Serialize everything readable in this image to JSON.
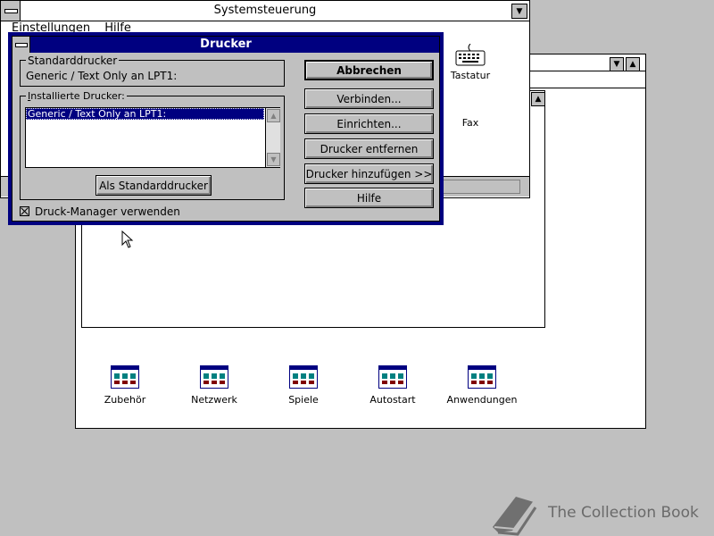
{
  "program_manager": {
    "groups": [
      {
        "label": "Zubehör",
        "icon": "program-group-icon"
      },
      {
        "label": "Netzwerk",
        "icon": "program-group-icon"
      },
      {
        "label": "Spiele",
        "icon": "program-group-icon"
      },
      {
        "label": "Autostart",
        "icon": "program-group-icon"
      },
      {
        "label": "Anwendungen",
        "icon": "program-group-icon"
      }
    ]
  },
  "control_panel": {
    "title": "Systemsteuerung",
    "menu": [
      "Einstellungen",
      "Hilfe"
    ],
    "items": [
      {
        "label": "Tastatur",
        "icon": "keyboard-icon"
      },
      {
        "label": "Fax",
        "icon": "fax-icon"
      }
    ]
  },
  "dialog": {
    "title": "Drucker",
    "default_printer_label": "Standarddrucker",
    "default_printer_value": "Generic / Text Only an LPT1:",
    "installed_label": "Installierte Drucker:",
    "installed_list": [
      "Generic / Text Only an LPT1:"
    ],
    "set_default_button": "Als Standarddrucker",
    "print_manager_checkbox": "Druck-Manager verwenden",
    "print_manager_checked": true,
    "buttons": {
      "cancel": "Abbrechen",
      "connect": "Verbinden...",
      "setup": "Einrichten...",
      "remove": "Drucker entfernen",
      "add": "Drucker hinzufügen >>",
      "help": "Hilfe"
    }
  },
  "watermark": {
    "text": "The Collection Book",
    "icon": "book-icon"
  },
  "colors": {
    "desktop": "#c0c0c0",
    "titlebar_active": "#000080",
    "selection": "#000080"
  }
}
